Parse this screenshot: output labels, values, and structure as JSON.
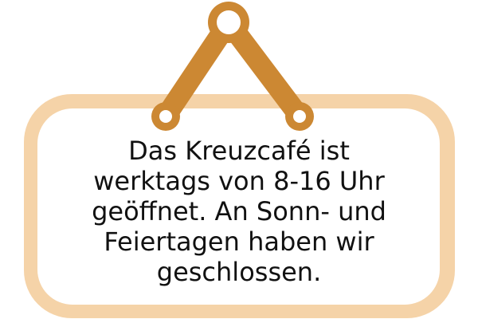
{
  "sign": {
    "message_lines": [
      "Das Kreuzcafé ist",
      "werktags von 8-16 Uhr",
      "geöffnet. An Sonn- und",
      "Feiertagen haben wir",
      "geschlossen."
    ]
  },
  "colors": {
    "frame": "#f5d3a8",
    "panel": "#ffffff",
    "hanger": "#cc8833",
    "text": "#111111"
  },
  "icons": {
    "hanger": "hanging-sign-hanger-icon"
  }
}
